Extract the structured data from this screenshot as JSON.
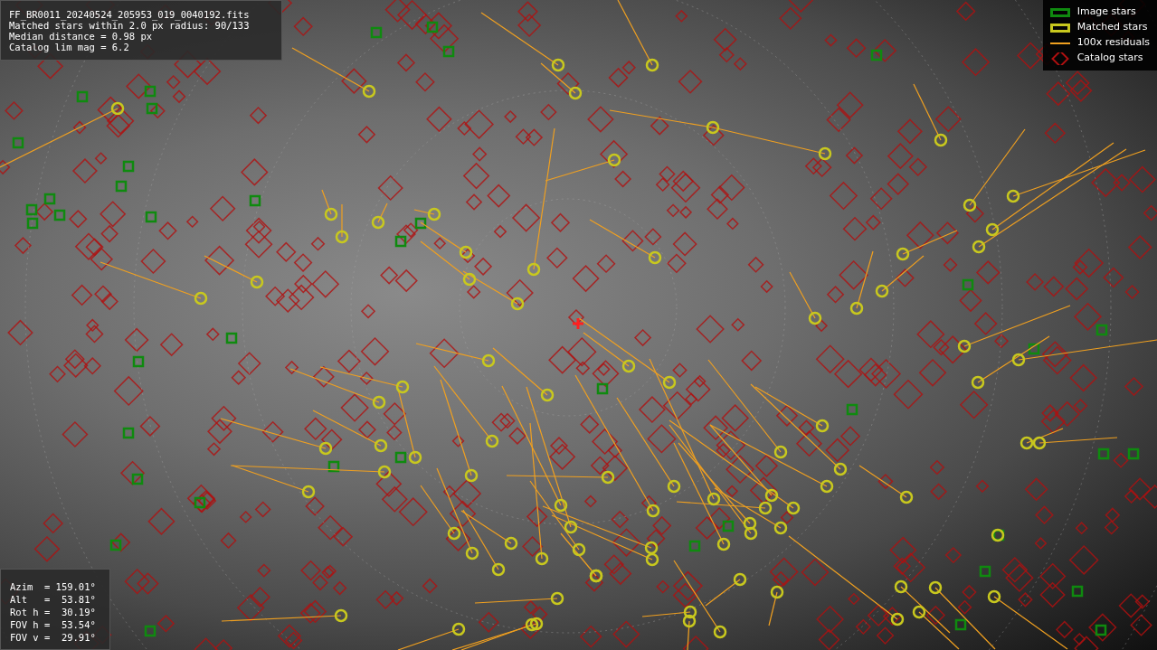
{
  "file_info": {
    "lines": [
      "FF_BR0011_20240524_205953_019_0040192.fits",
      "Matched stars within 2.0 px radius: 90/133",
      "Median distance = 0.98 px",
      "Catalog lim mag = 6.2"
    ]
  },
  "legend": [
    {
      "kind": "square",
      "label": "Image stars",
      "color": "#0f8a0f"
    },
    {
      "kind": "square",
      "label": "Matched stars",
      "color": "#c8c81e"
    },
    {
      "kind": "line",
      "label": "100x residuals",
      "color": "#f0a020"
    },
    {
      "kind": "diamond",
      "label": "Catalog stars",
      "color": "#b01010"
    }
  ],
  "pointing": {
    "lines": [
      "Azim  = 159.01°",
      "Alt   =  53.81°",
      "Rot h =  30.19°",
      "FOV h =  53.54°",
      "FOV v =  29.91°"
    ]
  }
}
